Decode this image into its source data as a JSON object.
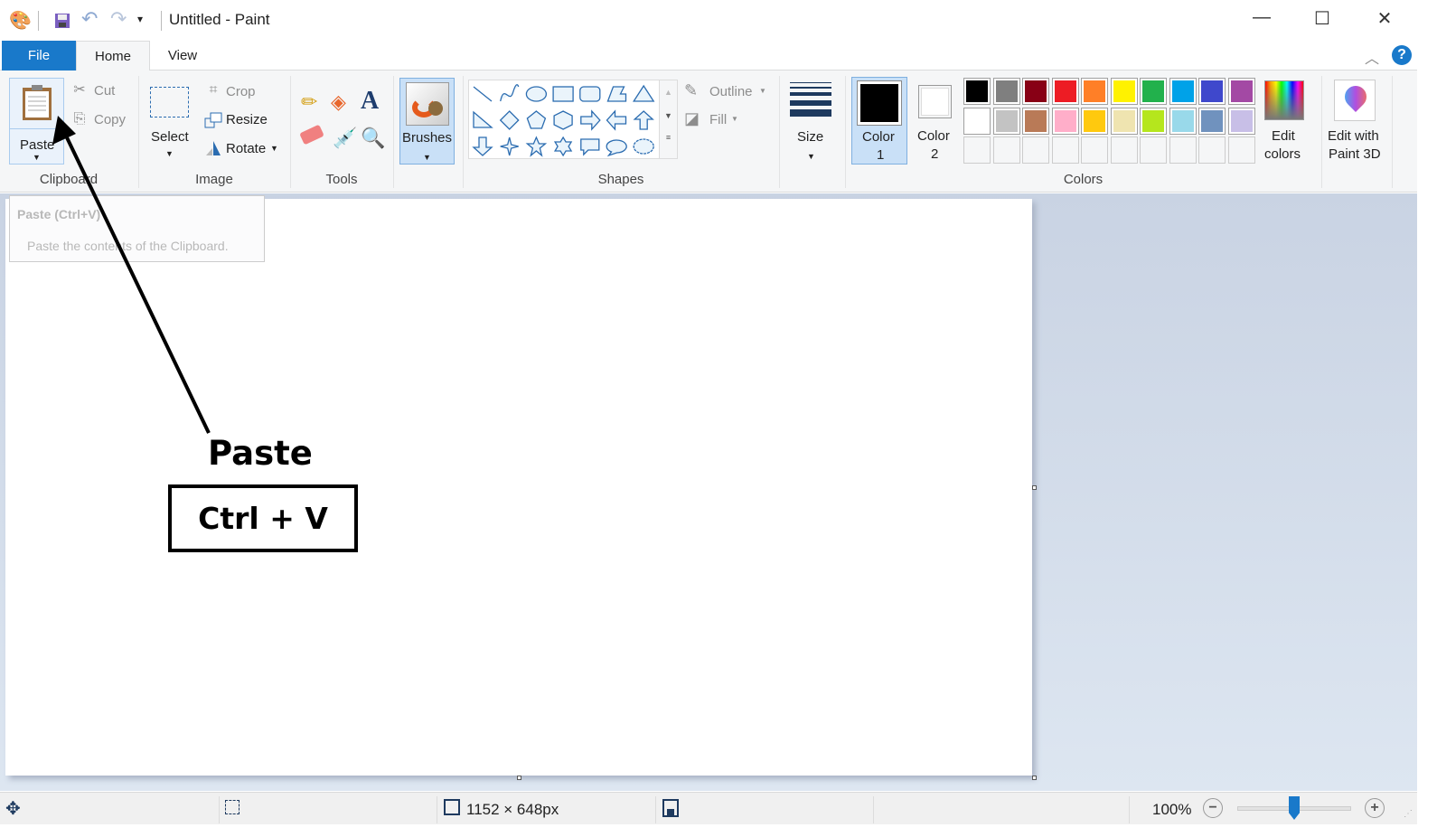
{
  "window": {
    "title": "Untitled - Paint",
    "qat_icons": [
      "paint-app-icon",
      "save-icon",
      "undo-icon",
      "redo-icon",
      "customize-qat-icon"
    ],
    "controls": [
      "minimize-icon",
      "maximize-icon",
      "close-icon"
    ]
  },
  "tabs": [
    {
      "label": "File"
    },
    {
      "label": "Home"
    },
    {
      "label": "View"
    }
  ],
  "ribbon": {
    "clipboard": {
      "label": "Clipboard",
      "paste": "Paste",
      "cut": "Cut",
      "copy": "Copy"
    },
    "image": {
      "label": "Image",
      "select": "Select",
      "crop": "Crop",
      "resize": "Resize",
      "rotate": "Rotate"
    },
    "tools": {
      "label": "Tools",
      "items": [
        "pencil-icon",
        "fill-bucket-icon",
        "text-icon",
        "eraser-icon",
        "color-picker-icon",
        "magnifier-icon"
      ]
    },
    "brushes": {
      "label": "Brushes"
    },
    "shapes": {
      "label": "Shapes",
      "outline": "Outline",
      "fill": "Fill",
      "items": [
        "line",
        "curve",
        "oval",
        "rectangle",
        "rounded-rectangle",
        "polygon",
        "triangle",
        "right-triangle",
        "diamond",
        "pentagon",
        "hexagon",
        "right-arrow",
        "left-arrow",
        "up-arrow",
        "down-arrow",
        "four-point-star",
        "five-point-star",
        "six-point-star",
        "rounded-callout",
        "oval-callout",
        "cloud-callout"
      ]
    },
    "size": {
      "label": "Size"
    },
    "colors": {
      "label": "Colors",
      "color1_a": "Color",
      "color1_b": "1",
      "color2_a": "Color",
      "color2_b": "2",
      "color1": "#000000",
      "color2": "#ffffff",
      "palette": [
        "#000000",
        "#7f7f7f",
        "#880015",
        "#ed1c24",
        "#ff7f27",
        "#fff200",
        "#22b14c",
        "#00a2e8",
        "#3f48cc",
        "#a349a4",
        "#ffffff",
        "#c3c3c3",
        "#b97a57",
        "#ffaec9",
        "#ffc90e",
        "#efe4b0",
        "#b5e61d",
        "#99d9ea",
        "#7092be",
        "#c8bfe7"
      ],
      "edit_a": "Edit",
      "edit_b": "colors"
    },
    "paint3d": {
      "a": "Edit with",
      "b": "Paint 3D"
    }
  },
  "tooltip": {
    "title": "Paste (Ctrl+V)",
    "body": "Paste the contents of the Clipboard."
  },
  "annotation": {
    "label": "Paste",
    "shortcut": "Ctrl + V"
  },
  "status": {
    "dimensions": "1152 × 648px",
    "zoom": "100%",
    "zoom_level_percent": 100
  },
  "accent": "#1979ca"
}
